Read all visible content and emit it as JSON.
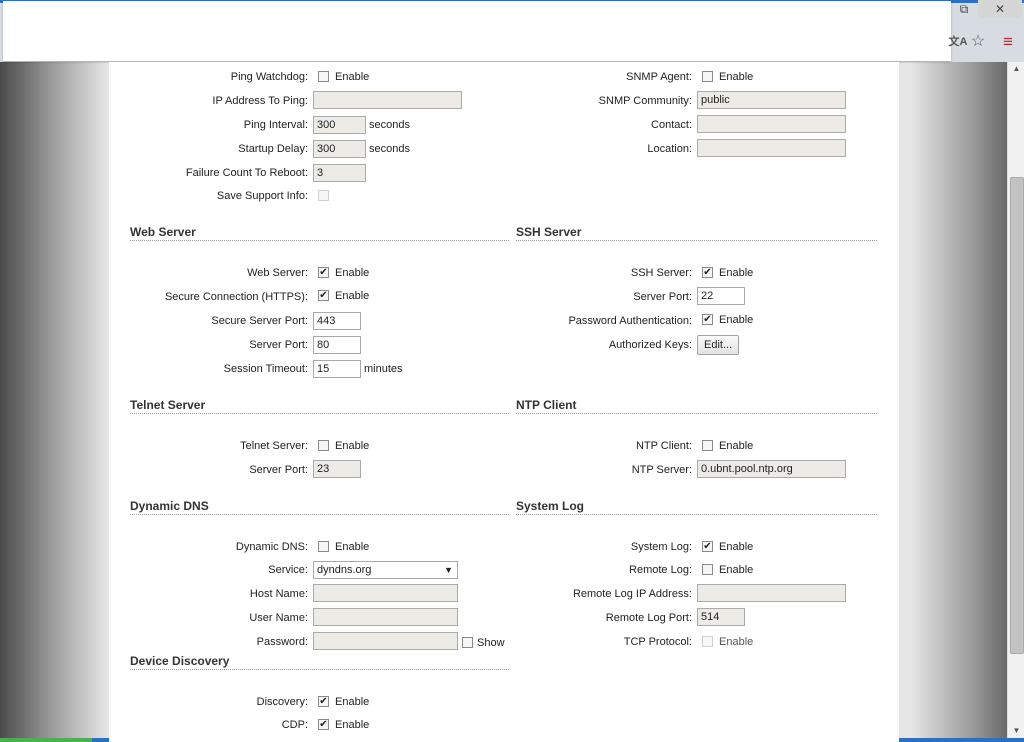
{
  "window": {
    "restore_glyph": "⧉",
    "close_glyph": "✕"
  },
  "toolbar": {
    "translate_glyph": "文A",
    "star_glyph": "☆",
    "menu_glyph": "≡"
  },
  "scroll": {
    "up_glyph": "▲",
    "down_glyph": "▼"
  },
  "check_glyph": "✔",
  "enable_text": "Enable",
  "ping": {
    "watchdog_label": "Ping Watchdog:",
    "ip_label": "IP Address To Ping:",
    "ip_value": "",
    "interval_label": "Ping Interval:",
    "interval_value": "300",
    "startup_label": "Startup Delay:",
    "startup_value": "300",
    "seconds_unit": "seconds",
    "failure_label": "Failure Count To Reboot:",
    "failure_value": "3",
    "support_label": "Save Support Info:"
  },
  "snmp": {
    "agent_label": "SNMP Agent:",
    "community_label": "SNMP Community:",
    "community_value": "public",
    "contact_label": "Contact:",
    "contact_value": "",
    "location_label": "Location:",
    "location_value": ""
  },
  "web": {
    "title": "Web Server",
    "server_label": "Web Server:",
    "https_label": "Secure Connection (HTTPS):",
    "secure_port_label": "Secure Server Port:",
    "secure_port_value": "443",
    "port_label": "Server Port:",
    "port_value": "80",
    "timeout_label": "Session Timeout:",
    "timeout_value": "15",
    "minutes_unit": "minutes"
  },
  "ssh": {
    "title": "SSH Server",
    "server_label": "SSH Server:",
    "port_label": "Server Port:",
    "port_value": "22",
    "password_label": "Password Authentication:",
    "keys_label": "Authorized Keys:",
    "edit_button": "Edit..."
  },
  "telnet": {
    "title": "Telnet Server",
    "server_label": "Telnet Server:",
    "port_label": "Server Port:",
    "port_value": "23"
  },
  "ntp": {
    "title": "NTP Client",
    "client_label": "NTP Client:",
    "server_label": "NTP Server:",
    "server_value": "0.ubnt.pool.ntp.org"
  },
  "ddns": {
    "title": "Dynamic DNS",
    "ddns_label": "Dynamic DNS:",
    "service_label": "Service:",
    "service_value": "dyndns.org",
    "arrow_glyph": "▼",
    "host_label": "Host Name:",
    "host_value": "",
    "user_label": "User Name:",
    "user_value": "",
    "password_label": "Password:",
    "password_value": "",
    "show_label": "Show"
  },
  "syslog": {
    "title": "System Log",
    "system_label": "System Log:",
    "remote_label": "Remote Log:",
    "remote_ip_label": "Remote Log IP Address:",
    "remote_ip_value": "",
    "remote_port_label": "Remote Log Port:",
    "remote_port_value": "514",
    "tcp_label": "TCP Protocol:"
  },
  "discovery": {
    "title": "Device Discovery",
    "discovery_label": "Discovery:",
    "cdp_label": "CDP:"
  }
}
